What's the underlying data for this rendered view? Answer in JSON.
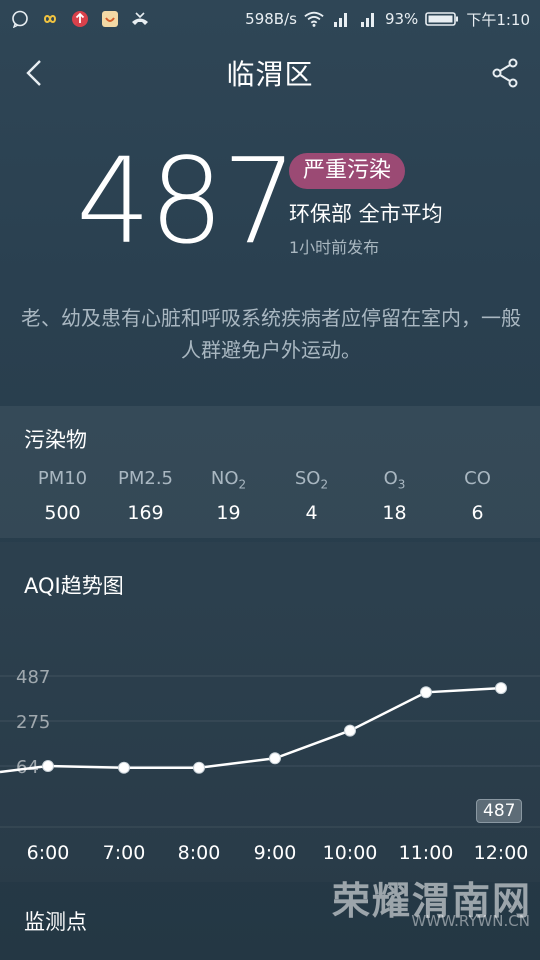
{
  "status_bar": {
    "network_speed": "598B/s",
    "battery": "93%",
    "time": "下午1:10"
  },
  "header": {
    "title": "临渭区"
  },
  "aqi": {
    "value": "487",
    "level": "严重污染",
    "source": "环保部 全市平均",
    "published": "1小时前发布",
    "level_color": "#9b4a74"
  },
  "advice": "老、幼及患有心脏和呼吸系统疾病者应停留在室内，一般人群避免户外运动。",
  "pollutants": {
    "title": "污染物",
    "items": [
      {
        "name": "PM10",
        "sub": "",
        "value": "500"
      },
      {
        "name": "PM2.5",
        "sub": "",
        "value": "169"
      },
      {
        "name": "NO",
        "sub": "2",
        "value": "19"
      },
      {
        "name": "SO",
        "sub": "2",
        "value": "4"
      },
      {
        "name": "O",
        "sub": "3",
        "value": "18"
      },
      {
        "name": "CO",
        "sub": "",
        "value": "6"
      }
    ]
  },
  "trend": {
    "title": "AQI趋势图",
    "tooltip_value": "487"
  },
  "chart_data": {
    "type": "line",
    "title": "AQI趋势图",
    "x": [
      "6:00",
      "7:00",
      "8:00",
      "9:00",
      "10:00",
      "11:00",
      "12:00"
    ],
    "y_ticks": [
      "487",
      "275",
      "64"
    ],
    "series": [
      {
        "values": [
          64,
          50,
          50,
          100,
          230,
          410,
          430
        ]
      }
    ],
    "ylim": [
      0,
      487
    ],
    "grid": true,
    "line_color": "#ffffff"
  },
  "monitor": {
    "title": "监测点"
  },
  "watermark": {
    "main": "荣耀渭南网",
    "sub": "WWW.RYWN.CN"
  }
}
